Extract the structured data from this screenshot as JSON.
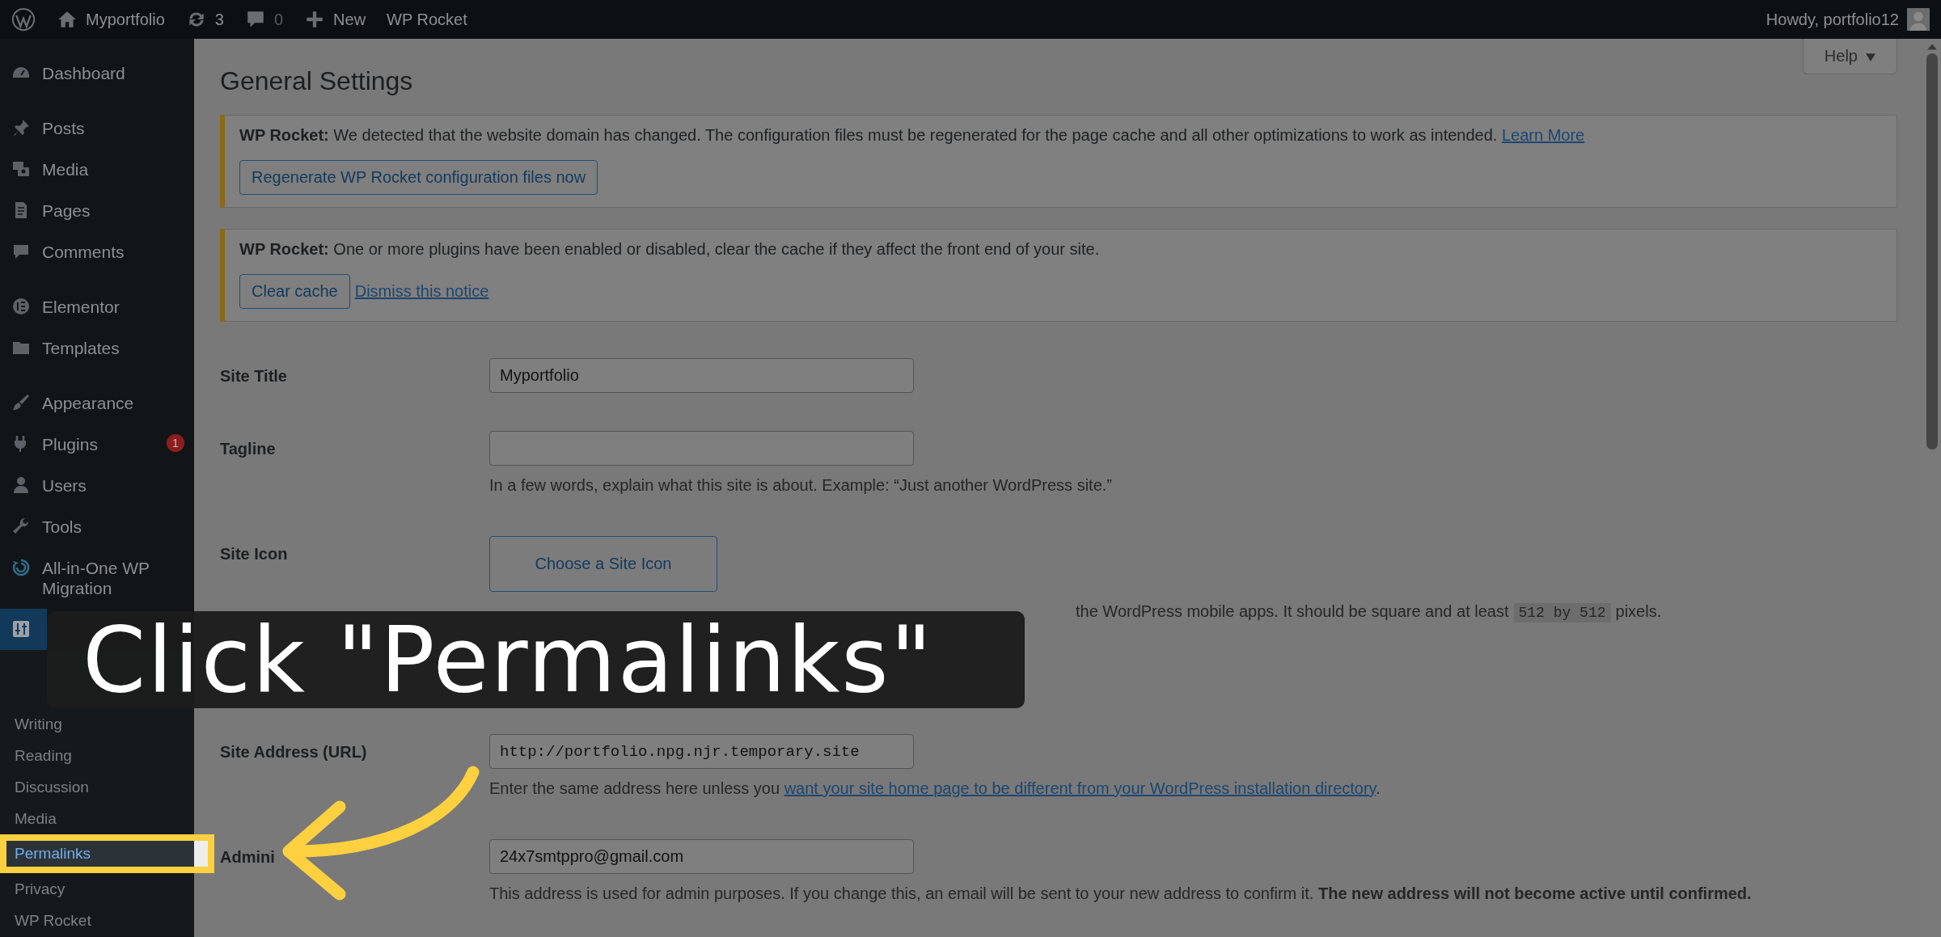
{
  "admin_bar": {
    "site_name": "Myportfolio",
    "updates": "3",
    "comments": "0",
    "new_label": "New",
    "plugin_link": "WP Rocket",
    "greeting": "Howdy, portfolio12"
  },
  "sidebar": {
    "groups": [
      {
        "items": [
          {
            "label": "Dashboard",
            "selected": false
          }
        ]
      },
      {
        "items": [
          {
            "label": "Posts",
            "selected": false
          },
          {
            "label": "Media",
            "selected": false
          },
          {
            "label": "Pages",
            "selected": false
          },
          {
            "label": "Comments",
            "selected": false
          }
        ]
      },
      {
        "items": [
          {
            "label": "Elementor",
            "selected": false
          },
          {
            "label": "Templates",
            "selected": false
          }
        ]
      },
      {
        "items": [
          {
            "label": "Appearance",
            "selected": false
          },
          {
            "label": "Plugins",
            "badge": "1",
            "selected": false
          },
          {
            "label": "Users",
            "selected": false
          },
          {
            "label": "Tools",
            "selected": false
          },
          {
            "label": "All-in-One WP Migration",
            "selected": false
          },
          {
            "selected": true,
            "submenu": [
              {
                "label": "Writing",
                "highlighted": false
              },
              {
                "label": "Reading",
                "highlighted": false
              },
              {
                "label": "Discussion",
                "highlighted": false
              },
              {
                "label": "Media",
                "highlighted": false
              },
              {
                "label": "Permalinks",
                "highlighted": true
              },
              {
                "label": "Privacy",
                "highlighted": false
              },
              {
                "label": "WP Rocket",
                "highlighted": false
              }
            ]
          }
        ]
      }
    ]
  },
  "help_tab": "Help",
  "page_title": "General Settings",
  "notices": [
    {
      "message": "**WP Rocket:** We detected that the website domain has changed. The configuration files must be regenerated for the page cache and all other optimizations to work as intended.",
      "message_link": "Learn More",
      "actions": [
        {
          "kind": "button",
          "label": "Regenerate WP Rocket configuration files now"
        }
      ]
    },
    {
      "message": "**WP Rocket:** One or more plugins have been enabled or disabled, clear the cache if they affect the front end of your site.",
      "actions": [
        {
          "kind": "button",
          "label": "Clear cache"
        },
        {
          "kind": "link",
          "label": "Dismiss this notice"
        }
      ]
    }
  ],
  "fields": [
    {
      "kind": "text",
      "label": "Site Title",
      "value": "Myportfolio"
    },
    {
      "kind": "text",
      "label": "Tagline",
      "description": "In a few words, explain what this site is about. Example: “Just another WordPress site.”"
    },
    {
      "kind": "icon_button",
      "label": "Site Icon",
      "button": "Choose a Site Icon",
      "description": "the WordPress mobile apps. It should be square and at least",
      "code": "512 by 512",
      "description_after": "pixels."
    },
    {
      "kind": "url",
      "label": "Site Address (URL)",
      "value": "http://portfolio.npg.njr.temporary.site",
      "description": "Enter the same address here unless you",
      "description_link": "want your site home page to be different from your WordPress installation directory",
      "description_after": "."
    },
    {
      "kind": "text",
      "label": "Admini",
      "value": "24x7smtppro@gmail.com",
      "description": "This address is used for admin purposes. If you change this, an email will be sent to your new address to confirm it. **The new address will not become active until confirmed.**"
    }
  ],
  "tutorial": {
    "caption": "Click \"Permalinks\""
  }
}
